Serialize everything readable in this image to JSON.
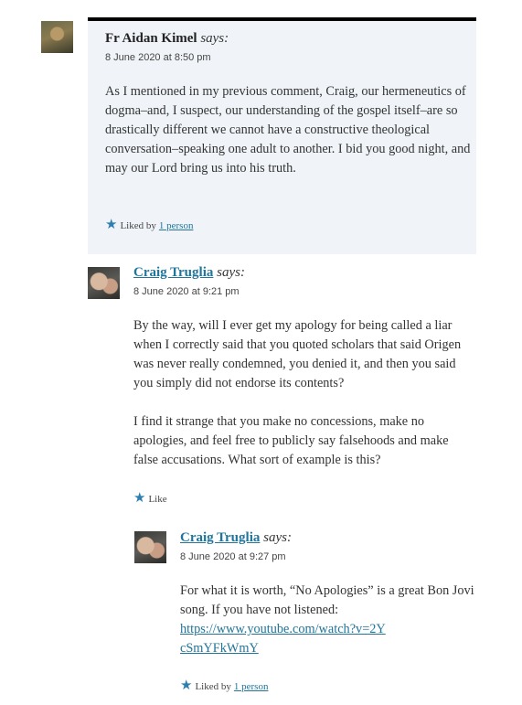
{
  "comments": [
    {
      "author": "Fr Aidan Kimel",
      "says": "says:",
      "date": "8 June 2020 at 8:50 pm",
      "paragraphs": [
        "As I mentioned in my previous comment, Craig, our hermeneutics of dogma–and, I suspect, our understanding of the gospel itself–are so drastically different we cannot have a constructive theological conversation–speaking one adult to another. I bid you good night, and may our Lord bring us into his truth."
      ],
      "likes_prefix": "Liked by",
      "likes_link": "1 person"
    },
    {
      "author": "Craig Truglia",
      "says": "says:",
      "date": "8 June 2020 at 9:21 pm",
      "paragraphs": [
        "By the way, will I ever get my apology for being called a liar when I correctly said that you quoted scholars that said Origen was never really condemned, you denied it, and then you said you simply did not endorse its contents?",
        "I find it strange that you make no concessions, make no apologies, and feel free to publicly say falsehoods and make false accusations. What sort of example is this?"
      ],
      "like_label": "Like"
    },
    {
      "author": "Craig Truglia",
      "says": "says:",
      "date": "8 June 2020 at 9:27 pm",
      "text": "For what it is worth, “No Apologies” is a great Bon Jovi song. If you have not listened:",
      "url": "https://www.youtube.com/watch?v=2YcSmYFkWmY",
      "likes_prefix": "Liked by",
      "likes_link": "1 person"
    }
  ],
  "icons": {
    "star": "star-icon",
    "avatar": "avatar"
  },
  "colors": {
    "link": "#21759b",
    "highlight_bg": "#f0f4f8",
    "star": "#2e7fb0"
  }
}
